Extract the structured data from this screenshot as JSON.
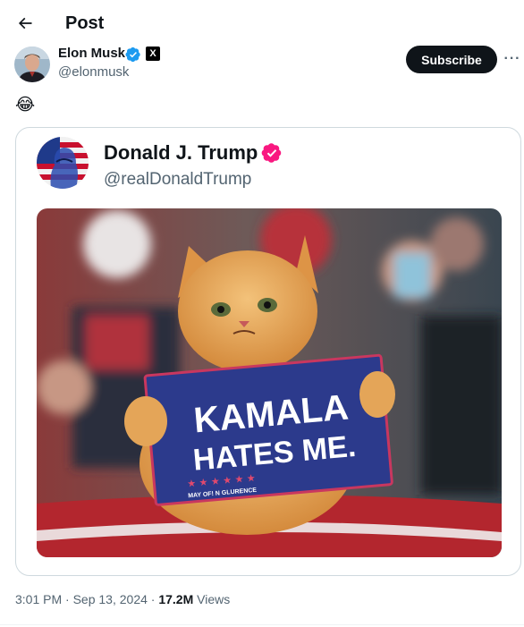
{
  "header": {
    "title": "Post",
    "back_icon": "arrow-left-icon"
  },
  "post": {
    "author_name": "Elon Musk",
    "author_handle": "@elonmusk",
    "verified_color": "#1d9bf0",
    "affiliate_badge": "X",
    "subscribe_label": "Subscribe",
    "more_label": "···",
    "body_emoji": "😂"
  },
  "quoted": {
    "author_name": "Donald J. Trump",
    "author_handle": "@realDonaldTrump",
    "verified_color": "#f91880",
    "image": {
      "sign_line1": "KAMALA",
      "sign_line2": "HATES ME.",
      "sign_footer": "MAY OF! N GLURENCE",
      "sign_stars": "★ ★ ★ ★ ★ ★",
      "sign_color": "#2c3a8c"
    }
  },
  "meta": {
    "time": "3:01 PM",
    "date": "Sep 13, 2024",
    "separator": "·",
    "views_count": "17.2M",
    "views_label": "Views"
  }
}
